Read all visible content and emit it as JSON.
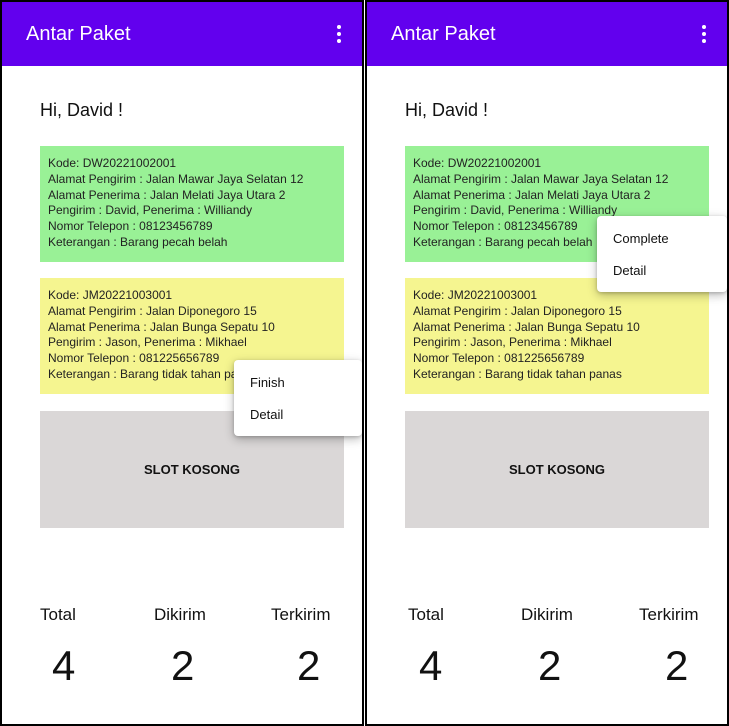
{
  "app": {
    "title": "Antar Paket",
    "more_icon": "more-vert-icon",
    "accent": "#6200ee"
  },
  "greeting": "Hi, David !",
  "deliveries": [
    {
      "color": "#99f196",
      "lines": [
        "Kode: DW20221002001",
        "Alamat Pengirim  : Jalan Mawar Jaya Selatan 12",
        "Alamat Penerima : Jalan Melati Jaya Utara 2",
        "Pengirim : David,  Penerima : Williandy",
        "Nomor Telepon : 08123456789",
        "Keterangan : Barang pecah belah"
      ]
    },
    {
      "color": "#f5f590",
      "lines": [
        "Kode: JM20221003001",
        "Alamat Pengirim  : Jalan Diponegoro 15",
        "Alamat Penerima :  Jalan Bunga Sepatu 10",
        "Pengirim : Jason,  Penerima : Mikhael",
        "Nomor Telepon : 081225656789",
        "Keterangan : Barang tidak tahan panas"
      ]
    }
  ],
  "empty_slot": "SLOT KOSONG",
  "menus": {
    "left": [
      "Finish",
      "Detail"
    ],
    "right": [
      "Complete",
      "Detail"
    ]
  },
  "stats": {
    "total_label": "Total",
    "sent_label": "Dikirim",
    "delivered_label": "Terkirim",
    "total_value": "4",
    "sent_value": "2",
    "delivered_value": "2"
  }
}
